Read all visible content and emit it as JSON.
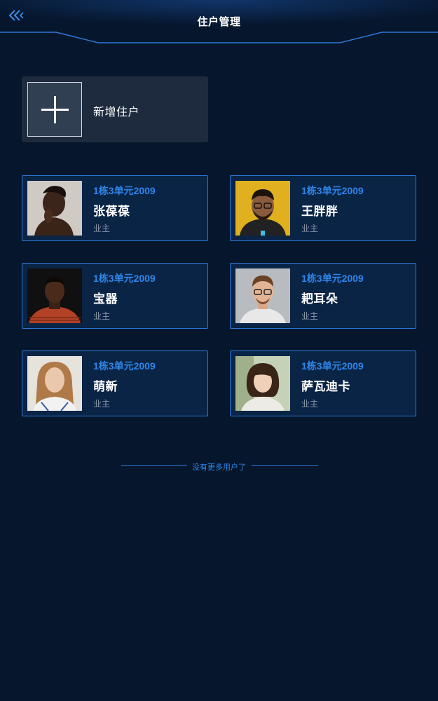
{
  "header": {
    "title": "住户管理",
    "back_icon": "double-chevron-left-icon"
  },
  "add_resident": {
    "label": "新增住户",
    "icon": "plus-icon"
  },
  "residents": [
    {
      "unit": "1栋3单元2009",
      "name": "张葆葆",
      "role": "业主",
      "avatar": "avatar-photo"
    },
    {
      "unit": "1栋3单元2009",
      "name": "王胖胖",
      "role": "业主",
      "avatar": "avatar-photo"
    },
    {
      "unit": "1栋3单元2009",
      "name": "宝器",
      "role": "业主",
      "avatar": "avatar-photo"
    },
    {
      "unit": "1栋3单元2009",
      "name": "耙耳朵",
      "role": "业主",
      "avatar": "avatar-photo"
    },
    {
      "unit": "1栋3单元2009",
      "name": "萌新",
      "role": "业主",
      "avatar": "avatar-photo"
    },
    {
      "unit": "1栋3单元2009",
      "name": "萨瓦迪卡",
      "role": "业主",
      "avatar": "avatar-photo"
    }
  ],
  "footer": {
    "end_text": "没有更多用户了"
  },
  "colors": {
    "background": "#06162c",
    "accent": "#2f86e8",
    "card_border": "#2d78d8"
  }
}
